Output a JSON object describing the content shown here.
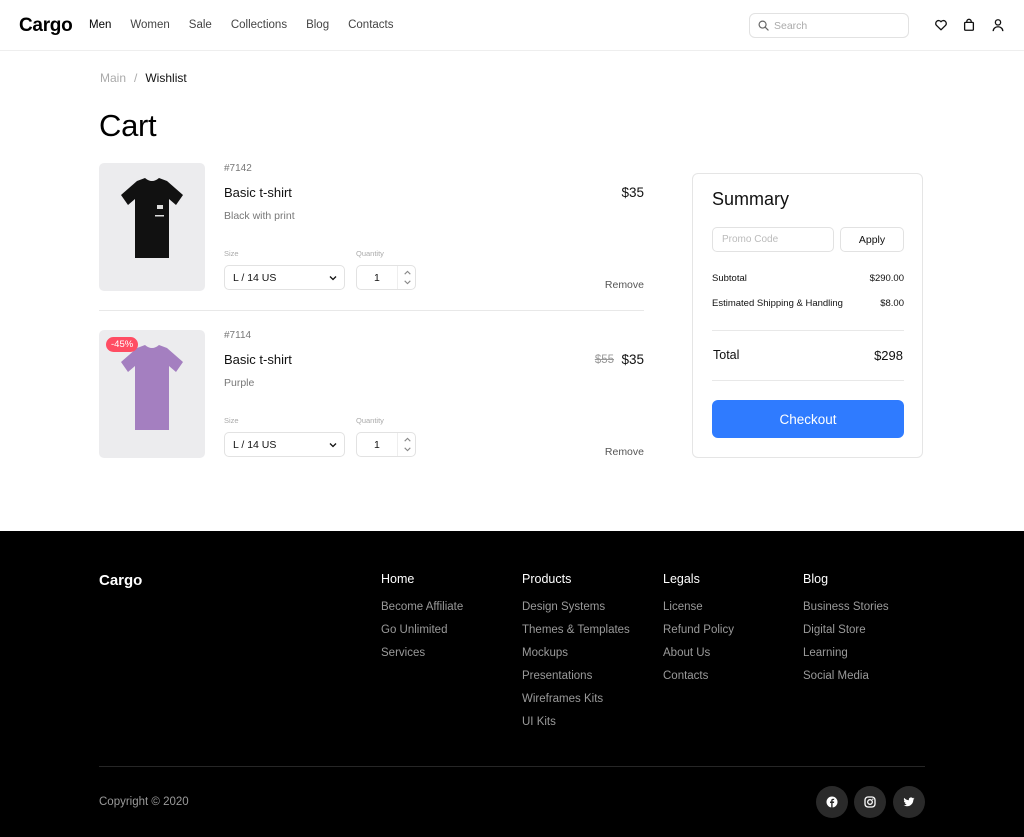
{
  "header": {
    "logo": "Cargo",
    "nav": [
      "Men",
      "Women",
      "Sale",
      "Collections",
      "Blog",
      "Contacts"
    ],
    "active_nav": "Men",
    "search_placeholder": "Search",
    "icons": [
      "search-icon",
      "heart-icon",
      "bag-icon",
      "user-icon"
    ]
  },
  "breadcrumb": {
    "root": "Main",
    "separator": "/",
    "current": "Wishlist"
  },
  "page_title": "Cart",
  "items": [
    {
      "sku": "#7142",
      "name": "Basic t-shirt",
      "variant": "Black with print",
      "price": "$35",
      "old_price": "",
      "badge": "",
      "size_label": "Size",
      "size": "L / 14 US",
      "qty_label": "Quantity",
      "quantity": "1",
      "remove": "Remove",
      "shirt_color": "#111111"
    },
    {
      "sku": "#7114",
      "name": "Basic t-shirt",
      "variant": "Purple",
      "price": "$35",
      "old_price": "$55",
      "badge": "-45%",
      "size_label": "Size",
      "size": "L / 14 US",
      "qty_label": "Quantity",
      "quantity": "1",
      "remove": "Remove",
      "shirt_color": "#a47fc0"
    }
  ],
  "summary": {
    "title": "Summary",
    "promo_placeholder": "Promo Code",
    "apply": "Apply",
    "subtotal_label": "Subtotal",
    "subtotal": "$290.00",
    "shipping_label": "Estimated Shipping & Handling",
    "shipping": "$8.00",
    "total_label": "Total",
    "total": "$298",
    "checkout": "Checkout",
    "accent": "#2f7bff"
  },
  "footer": {
    "logo": "Cargo",
    "columns": [
      {
        "heading": "Home",
        "links": [
          "Become Affiliate",
          "Go Unlimited",
          "Services"
        ]
      },
      {
        "heading": "Products",
        "links": [
          "Design Systems",
          "Themes & Templates",
          "Mockups",
          "Presentations",
          "Wireframes Kits",
          "UI Kits"
        ]
      },
      {
        "heading": "Legals",
        "links": [
          "License",
          "Refund Policy",
          "About Us",
          "Contacts"
        ]
      },
      {
        "heading": "Blog",
        "links": [
          "Business Stories",
          "Digital Store",
          "Learning",
          "Social Media"
        ]
      }
    ],
    "copyright": "Copyright © 2020",
    "social": [
      "facebook-icon",
      "instagram-icon",
      "twitter-icon"
    ]
  }
}
